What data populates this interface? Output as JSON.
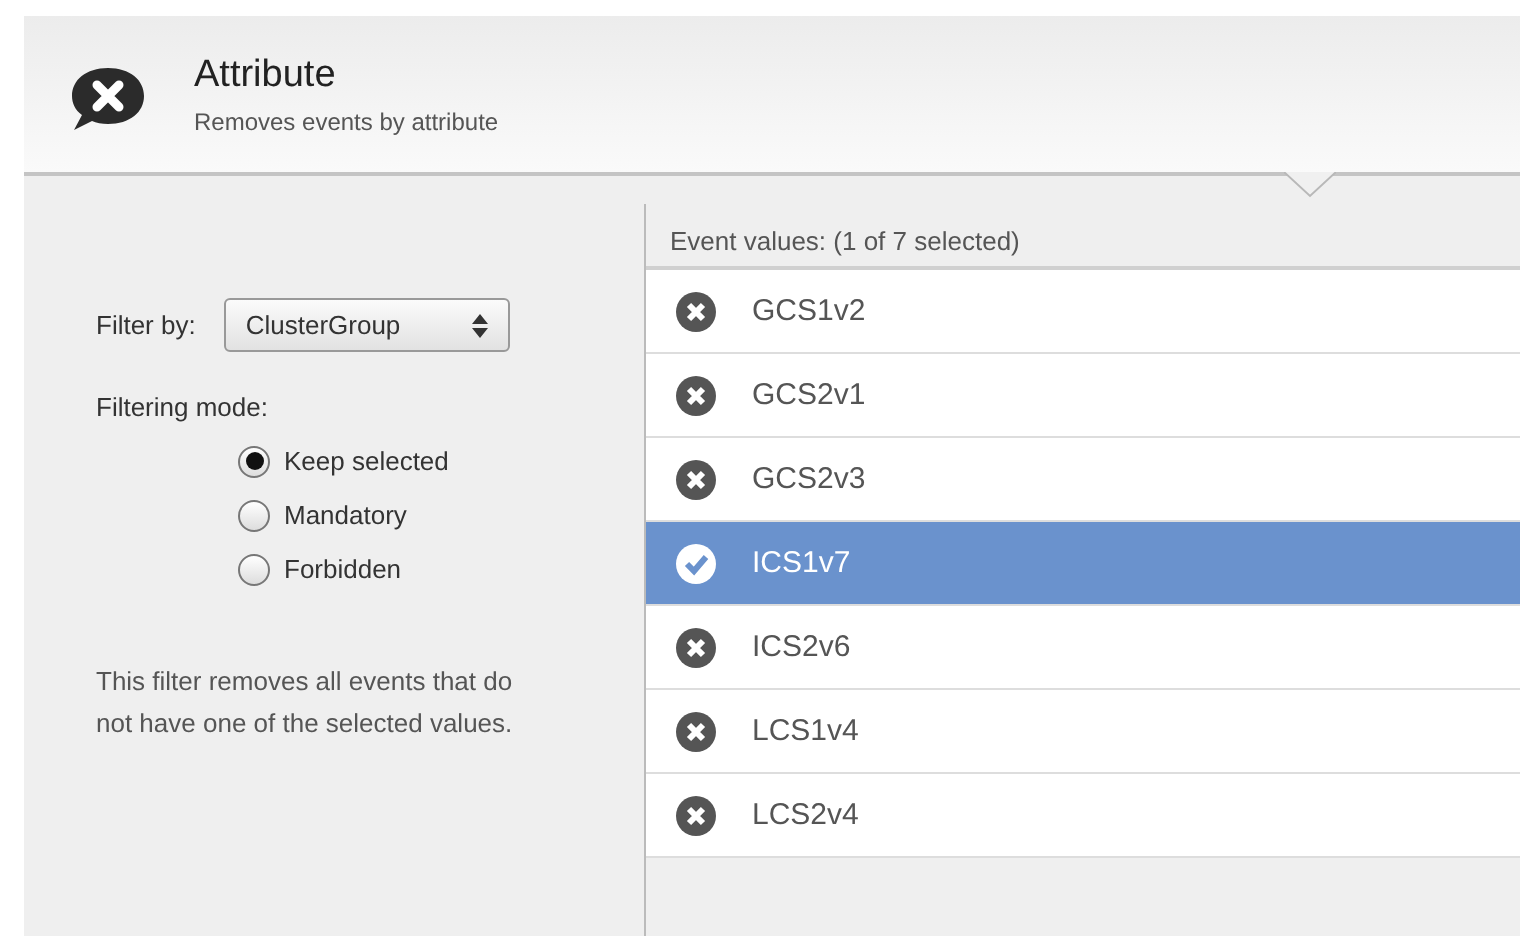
{
  "header": {
    "title": "Attribute",
    "subtitle": "Removes events by attribute"
  },
  "filter": {
    "label": "Filter by:",
    "value": "ClusterGroup"
  },
  "mode": {
    "label": "Filtering mode:",
    "options": [
      {
        "label": "Keep selected",
        "selected": true
      },
      {
        "label": "Mandatory",
        "selected": false
      },
      {
        "label": "Forbidden",
        "selected": false
      }
    ]
  },
  "description": "This filter removes all events that do not have one of the selected values.",
  "values": {
    "heading": "Event values:  (1 of 7 selected)",
    "items": [
      {
        "label": "GCS1v2",
        "selected": false
      },
      {
        "label": "GCS2v1",
        "selected": false
      },
      {
        "label": "GCS2v3",
        "selected": false
      },
      {
        "label": "ICS1v7",
        "selected": true
      },
      {
        "label": "ICS2v6",
        "selected": false
      },
      {
        "label": "LCS1v4",
        "selected": false
      },
      {
        "label": "LCS2v4",
        "selected": false
      }
    ]
  }
}
